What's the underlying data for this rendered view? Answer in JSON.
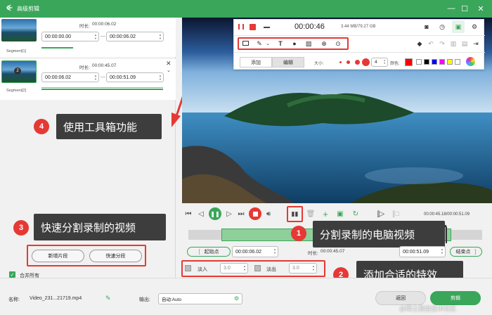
{
  "app": {
    "title": "高级剪辑",
    "logo": "ꔾ"
  },
  "window": {
    "minimize": "—",
    "maximize": "☐",
    "close": "✕"
  },
  "segments": [
    {
      "label": "Segment[1]",
      "badge": "",
      "duration_label": "时长:",
      "duration": "00:00:06.02",
      "start": "00:00:00.00",
      "end": "00:00:06.02"
    },
    {
      "label": "Segment[2]",
      "badge": "2",
      "duration_label": "时长:",
      "duration": "00:00:45.07",
      "start": "00:00:06.02",
      "end": "00:00:51.09"
    }
  ],
  "dash": "—",
  "callouts": [
    {
      "num": "4",
      "text": "使用工具箱功能"
    },
    {
      "num": "3",
      "text": "快速分割录制的视频"
    },
    {
      "num": "1",
      "text": "分割录制的电脑视频"
    },
    {
      "num": "2",
      "text": "添加合适的特效"
    }
  ],
  "left_buttons": {
    "new_segment": "新增片段",
    "quick_split": "快速分段"
  },
  "merge_all": "合并所有",
  "toolbar": {
    "time": "00:00:46",
    "size": "3.44 MB/79.27 GB",
    "tab_add": "添加",
    "tab_edit": "编辑",
    "size_label": "大小:",
    "line_size": "4",
    "color_label": "颜色:",
    "colors": [
      "#ff0000",
      "#ffffff",
      "#000000",
      "#0000ff",
      "#ff00ff",
      "#ffff00",
      "#ffffff"
    ]
  },
  "player": {
    "time": "00:00:45.18/00:00:51.09"
  },
  "trim": {
    "start_label": "起始点",
    "start_value": "00:00:06.02",
    "duration_label": "时长:",
    "duration_value": "00:00:45.07",
    "end_value": "00:00:51.09",
    "end_label": "结束点"
  },
  "effects": {
    "fade_in": "淡入",
    "fade_in_value": "3.0",
    "fade_out": "淡出",
    "fade_out_value": "3.0"
  },
  "bottom": {
    "name_label": "名称:",
    "file_name": "Video_231...21719.mp4",
    "output_label": "输出:",
    "output_value": "自动:Auto",
    "back": "返回",
    "export": "剪辑"
  },
  "watermark": "@稀土掘金技术社区"
}
